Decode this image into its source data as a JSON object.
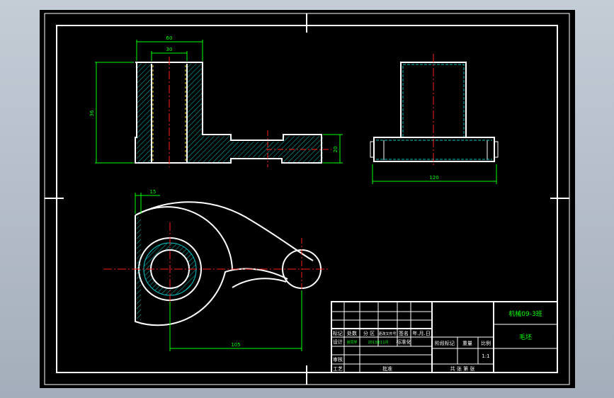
{
  "colors": {
    "outline": "#ffffff",
    "dimension": "#00ff00",
    "centerline": "#ff2020",
    "hatch": "#00c8c8",
    "hidden_yellow": "#ffe000",
    "background": "#000000"
  },
  "dimensions": {
    "top_width_outer": "60",
    "top_width_inner": "30",
    "front_height": "36",
    "rod_dia": "20",
    "side_width": "120",
    "plan_offset": "15",
    "plan_center_dist": "105"
  },
  "title_block": {
    "part_name": "机械09-3班",
    "material": "毛坯",
    "scale": "1:1",
    "sheets": "共 张 第 张",
    "r1": {
      "mark": "标记",
      "count": "处数",
      "zone": "分 区",
      "doc": "更改文件号",
      "sign": "签名",
      "date": "年.月.日"
    },
    "r2": {
      "design": "设计",
      "name": "张同学",
      "date": "2013年11月",
      "std": "标准化"
    },
    "r3": {
      "stage": "阶段标记",
      "weight": "重量",
      "ratio": "比例"
    },
    "r4": {
      "check": "审核"
    },
    "r5": {
      "process": "工艺",
      "approve": "批准"
    }
  }
}
